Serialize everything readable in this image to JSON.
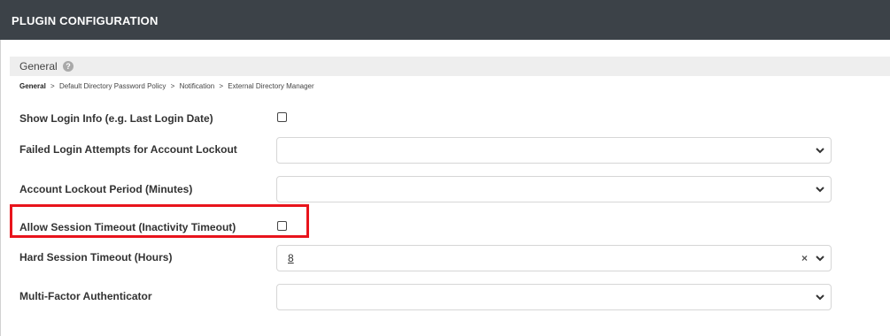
{
  "header": {
    "title": "PLUGIN CONFIGURATION"
  },
  "section": {
    "title": "General",
    "help_icon": "question-circle-icon"
  },
  "breadcrumb": {
    "current": "General",
    "separator": ">",
    "items": [
      "Default Directory Password Policy",
      "Notification",
      "External Directory Manager"
    ]
  },
  "fields": [
    {
      "label": "Show Login Info (e.g. Last Login Date)",
      "type": "checkbox",
      "checked": false
    },
    {
      "label": "Failed Login Attempts for Account Lockout",
      "type": "select",
      "value": ""
    },
    {
      "label": "Account Lockout Period (Minutes)",
      "type": "select",
      "value": ""
    },
    {
      "label": "Allow Session Timeout (Inactivity Timeout)",
      "type": "checkbox",
      "checked": false,
      "highlighted": true
    },
    {
      "label": "Hard Session Timeout (Hours)",
      "type": "select",
      "value": "8",
      "clear_icon": "close-x-icon"
    },
    {
      "label": "Multi-Factor Authenticator",
      "type": "select",
      "value": ""
    }
  ],
  "colors": {
    "header_bg": "#3c4248",
    "section_bg": "#eeeeee",
    "highlight": "#e8141c"
  }
}
